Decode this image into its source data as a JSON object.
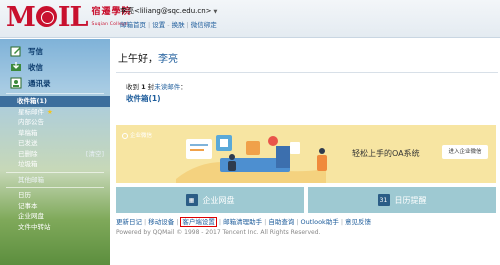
{
  "header": {
    "logo_mark": "MOIL",
    "logo_cn": "宿遷學院",
    "logo_en": "Suqian College",
    "user_email": "李亮<liliang@sqc.edu.cn>",
    "links": [
      "邮箱首页",
      "设置",
      "换肤",
      "微信绑定"
    ]
  },
  "sidebar": {
    "compose": "写信",
    "receive": "收信",
    "contacts": "通讯录",
    "inbox": "收件箱(1)",
    "starred": "星标邮件",
    "folders": [
      "内部公告",
      "草稿箱",
      "已发送",
      "已删除",
      "垃圾箱"
    ],
    "clear_label": "[清空]",
    "other": "其他邮箱",
    "calendar": "日历",
    "notes": "记事本",
    "enterprise_disk": "企业网盘",
    "file_transfer": "文件中转站"
  },
  "main": {
    "greeting": "上午好，",
    "user_name": "李亮",
    "notice_prefix": "收到 ",
    "notice_count": "1",
    "notice_suffix": " 封",
    "notice_link": "未读邮件",
    "notice_colon": "：",
    "inbox_link": "收件箱(1)",
    "banner": {
      "tag": "企业微信",
      "slogan": "轻松上手的OA系统",
      "cta": "进入企业微信"
    },
    "tiles": [
      {
        "label": "企业网盘",
        "icon": "disk-icon"
      },
      {
        "label": "日历提醒",
        "icon": "calendar-icon"
      }
    ],
    "footer_links": [
      "更新日记",
      "移动设备",
      "客户端设置",
      "邮箱清理助手",
      "自助查询",
      "Outlook助手",
      "意见反馈"
    ],
    "copyright": "Powered by QQMail © 1998 - 2017 Tencent Inc. All Rights Reserved."
  },
  "colors": {
    "brand": "#c8102e",
    "link": "#1d5c9b",
    "highlight": "#dd0000"
  }
}
